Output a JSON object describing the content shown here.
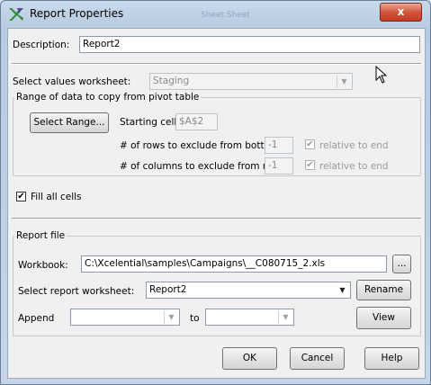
{
  "window": {
    "title": "Report Properties",
    "background_title": "Sheet Sheet",
    "close_label": "x"
  },
  "description": {
    "label": "Description:",
    "value": "Report2"
  },
  "values_worksheet": {
    "label": "Select values worksheet:",
    "value": "Staging"
  },
  "range_group": {
    "label": "Range of data to copy from pivot table",
    "select_range_button": "Select Range...",
    "starting_cell_label": "Starting cell:",
    "starting_cell_value": "$A$2",
    "rows_exclude_label": "# of rows to exclude from bottom:",
    "rows_exclude_value": "-1",
    "rows_relative_label": "relative to end",
    "rows_relative_checked": true,
    "cols_exclude_label": "# of columns to exclude from right:",
    "cols_exclude_value": "-1",
    "cols_relative_label": "relative to end",
    "cols_relative_checked": true
  },
  "fill_all_cells": {
    "label": "Fill all cells",
    "checked": true
  },
  "report_file": {
    "label": "Report file",
    "workbook_label": "Workbook:",
    "workbook_value": "C:\\Xcelential\\samples\\Campaigns\\__C080715_2.xls",
    "browse_label": "...",
    "report_worksheet_label": "Select report worksheet:",
    "report_worksheet_value": "Report2",
    "rename_label": "Rename",
    "append_label": "Append",
    "append_from_value": "",
    "to_label": "to",
    "append_to_value": "",
    "view_label": "View"
  },
  "footer": {
    "ok_label": "OK",
    "cancel_label": "Cancel",
    "help_label": "Help"
  },
  "icons": {
    "app": "xcelential-app-icon",
    "close": "close-icon",
    "dropdown": "chevron-down-icon",
    "cursor": "mouse-pointer-icon"
  },
  "colors": {
    "frame": "#c9d9ea",
    "client": "#f0f0f0",
    "close_button": "#d4553b",
    "app_icon_green": "#2e8b3a",
    "app_icon_purple": "#6b3fa0"
  }
}
